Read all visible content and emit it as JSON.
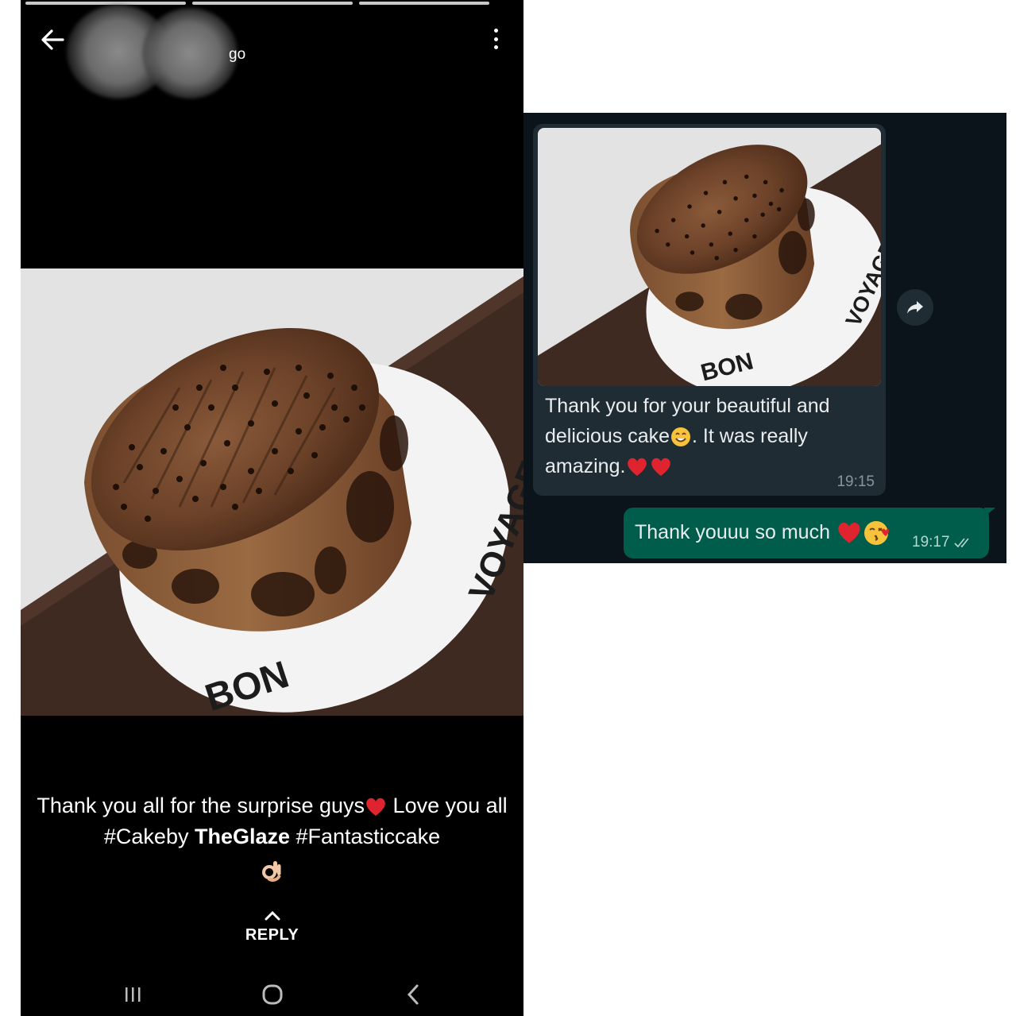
{
  "status_viewer": {
    "time_ago": "go",
    "caption": {
      "part1": "Thank you all for the surprise guys",
      "part2": " Love you all #Cakeby ",
      "brand": "TheGlaze",
      "part3": " #Fantasticcake"
    },
    "reply_label": "REPLY",
    "photo_text": {
      "left": "BON",
      "right": "VOYAGE !"
    },
    "icons": [
      "back-arrow-icon",
      "more-vertical-icon",
      "red-heart-icon",
      "ok-hand-icon",
      "chevron-up-icon",
      "recent-apps-icon",
      "home-icon",
      "nav-back-icon"
    ]
  },
  "chat": {
    "incoming": {
      "text_line1": "Thank you for your beautiful and",
      "text_line2a": "delicious cake",
      "text_line2b": ". It was really",
      "text_line3": "amazing.",
      "time": "19:15"
    },
    "outgoing": {
      "text": "Thank youuu so much",
      "time": "19:17"
    },
    "photo_text": {
      "left": "BON",
      "right": "VOYAGE !"
    },
    "colors": {
      "background": "#0b141a",
      "incoming_bubble": "#202c33",
      "outgoing_bubble": "#005c4b"
    },
    "icons": [
      "share-forward-icon",
      "smiling-face-icon",
      "red-heart-icon",
      "kissing-face-icon",
      "double-check-icon"
    ]
  }
}
